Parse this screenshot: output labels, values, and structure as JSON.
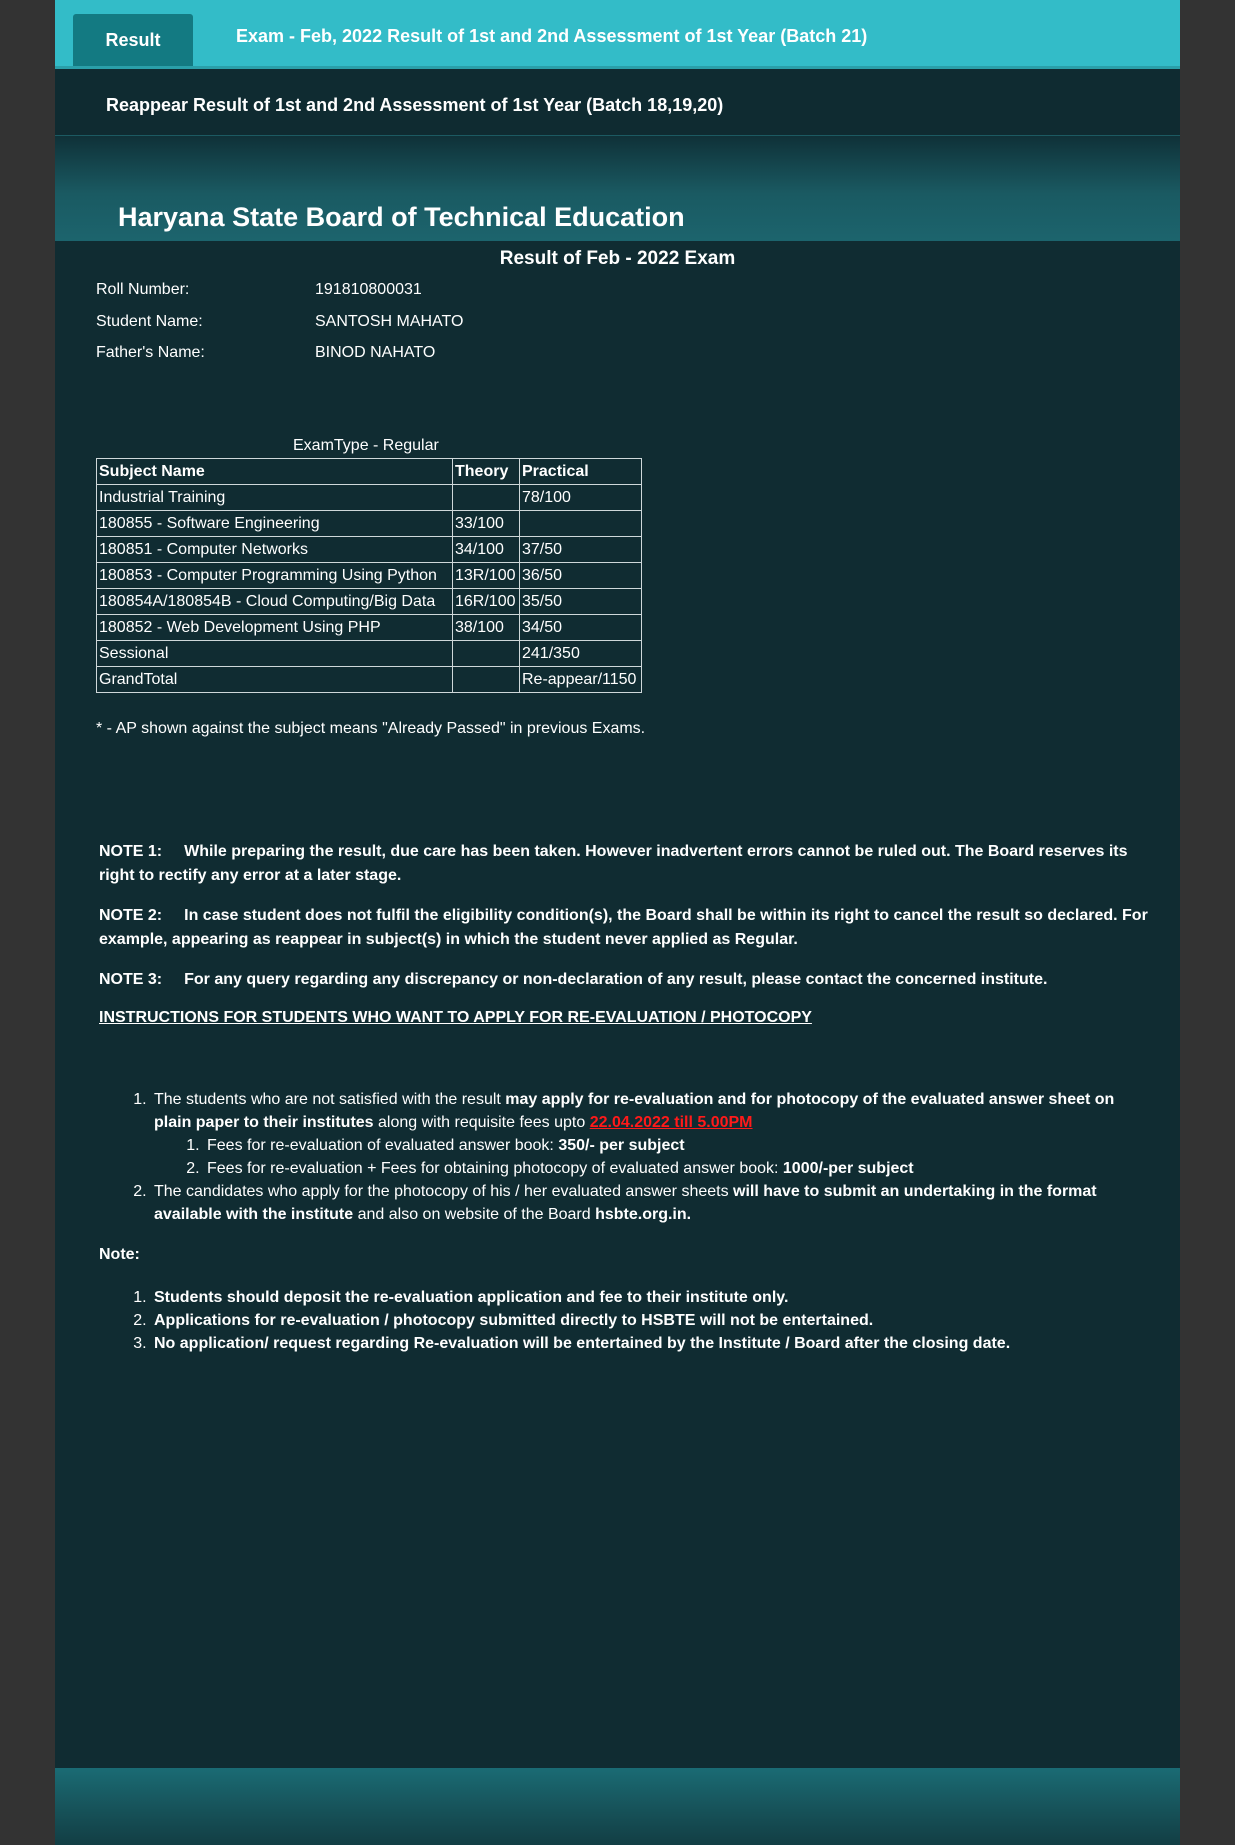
{
  "tabs": {
    "active": "Result",
    "exam_link": "Exam - Feb, 2022 Result of 1st and 2nd Assessment of 1st Year (Batch 21)",
    "reappear_link": "Reappear Result of 1st and 2nd Assessment of 1st Year (Batch 18,19,20)"
  },
  "banner": {
    "title": "Haryana State Board of Technical Education"
  },
  "result": {
    "heading": "Result of Feb - 2022 Exam",
    "student": [
      {
        "label": "Roll Number:",
        "value": "191810800031"
      },
      {
        "label": "Student Name:",
        "value": "SANTOSH MAHATO"
      },
      {
        "label": "Father's Name:",
        "value": "BINOD NAHATO"
      }
    ],
    "exam_type": "ExamType - Regular",
    "table": {
      "headers": [
        "Subject Name",
        "Theory",
        "Practical"
      ],
      "rows": [
        [
          "Industrial Training",
          "",
          "78/100"
        ],
        [
          "180855 - Software Engineering",
          "33/100",
          ""
        ],
        [
          "180851 - Computer Networks",
          "34/100",
          "37/50"
        ],
        [
          "180853 - Computer Programming Using Python",
          "13R/100",
          "36/50"
        ],
        [
          "180854A/180854B - Cloud Computing/Big Data",
          "16R/100",
          "35/50"
        ],
        [
          "180852 - Web Development Using PHP",
          "38/100",
          "34/50"
        ],
        [
          "Sessional",
          "",
          "241/350"
        ],
        [
          "GrandTotal",
          "",
          "Re-appear/1150"
        ]
      ]
    },
    "ap_note": "* - AP shown against the subject means \"Already Passed\" in previous Exams."
  },
  "notes": [
    {
      "label": "NOTE 1:",
      "text": "While preparing the result, due care has been taken. However inadvertent errors cannot be ruled out. The Board reserves its right to rectify any error at a later stage."
    },
    {
      "label": "NOTE 2:",
      "text": "In case student does not fulfil the eligibility condition(s), the Board shall be within its right to cancel the result so declared. For example, appearing as reappear in subject(s) in which the student never applied as Regular."
    },
    {
      "label": "NOTE 3:",
      "text": "For any query regarding any discrepancy or non-declaration of any result, please contact the concerned institute."
    }
  ],
  "instructions": {
    "title": "INSTRUCTIONS FOR STUDENTS WHO WANT TO APPLY FOR RE-EVALUATION / PHOTOCOPY",
    "item1": {
      "a": "The students who are not satisfied with the result ",
      "b": "may apply for re-evaluation and for photocopy of the evaluated answer sheet on plain paper to their institutes",
      "c": " along with requisite fees upto ",
      "date": "22.04.2022 till 5.00PM",
      "fees": [
        {
          "text": "Fees for re-evaluation of evaluated answer book:  ",
          "amount": "350/- per subject"
        },
        {
          "text": "Fees for re-evaluation + Fees for obtaining photocopy of evaluated answer book: ",
          "amount": "1000/-per subject"
        }
      ]
    },
    "item2": {
      "a": "The candidates who apply for the photocopy of his / her evaluated answer sheets ",
      "b": "will have to submit an undertaking in the format available with the institute",
      "c": " and also on website of the Board ",
      "d": "hsbte.org.in."
    }
  },
  "final_note": {
    "label": "Note:",
    "items": [
      "Students should deposit the re-evaluation application and fee to their institute only.",
      "Applications for re-evaluation / photocopy submitted directly to HSBTE will not be entertained.",
      "No application/ request regarding Re-evaluation will be entertained by the Institute / Board after the closing date."
    ]
  }
}
